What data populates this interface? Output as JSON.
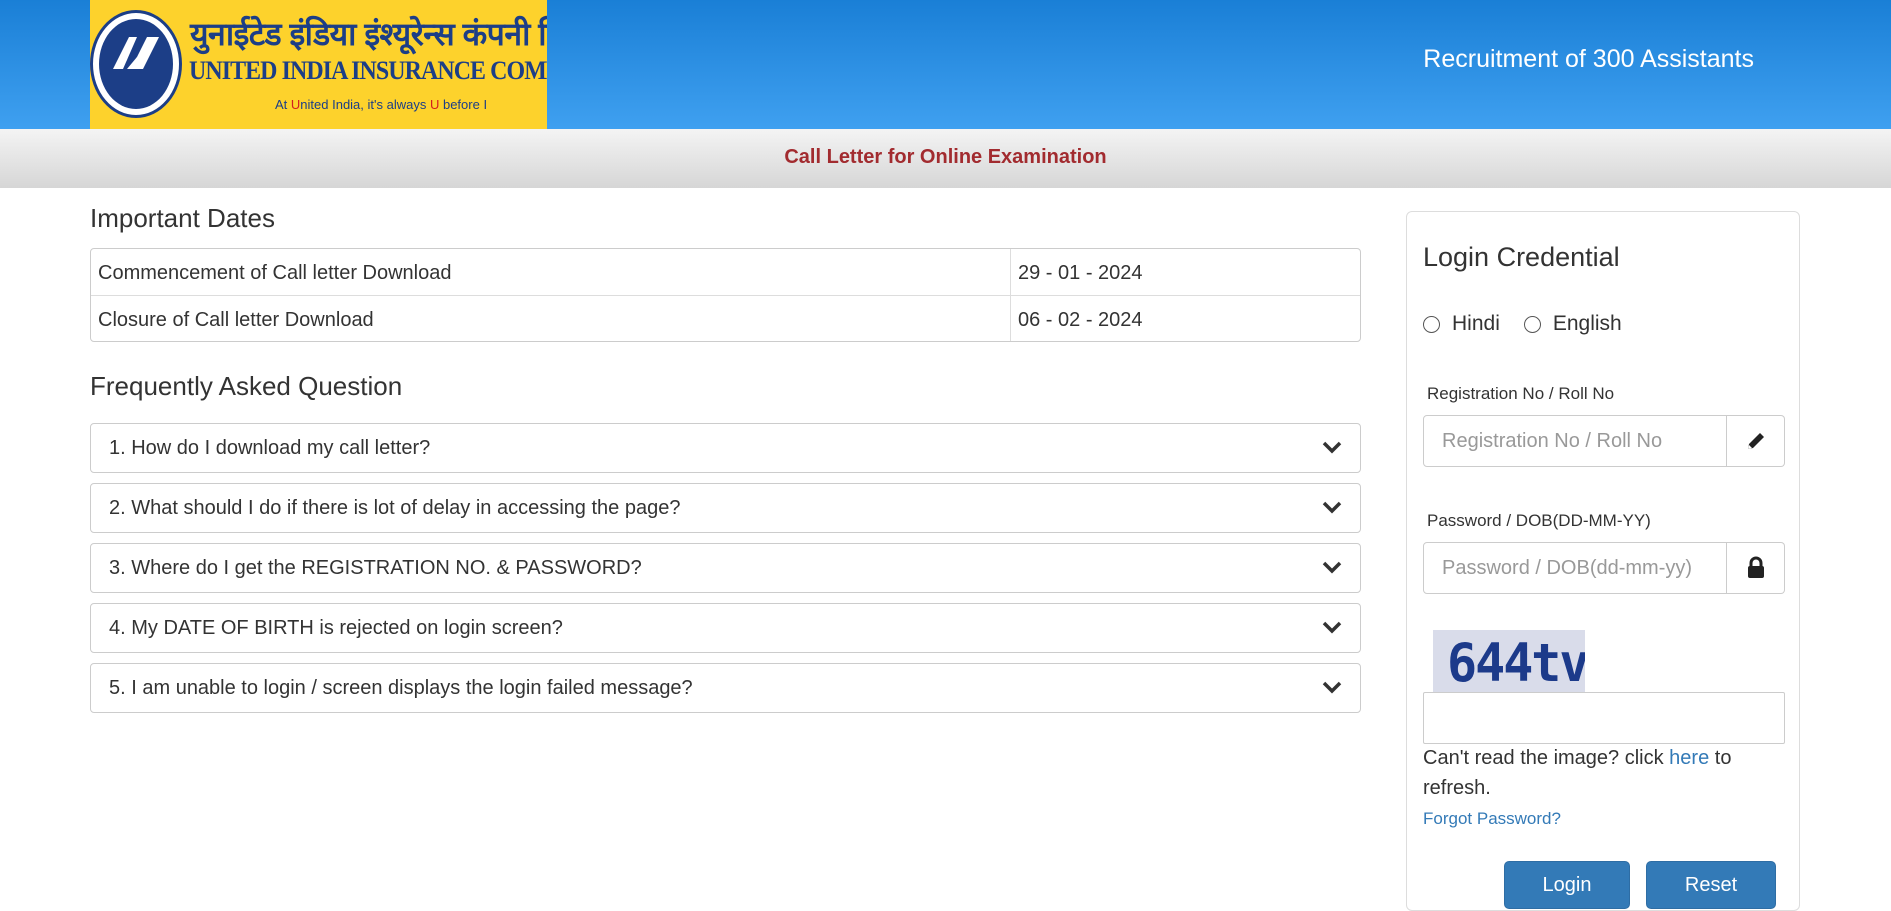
{
  "header": {
    "logo": {
      "hindi_name": "युनाईटेड इंडिया इंश्यूरेन्स कंपनी लिमिटेड",
      "english_name": "UNITED INDIA INSURANCE COMPANY LTD.",
      "tagline_prefix": "At ",
      "tagline_u1": "U",
      "tagline_mid": "nited India, it's always ",
      "tagline_u2": "U",
      "tagline_suffix": " before I",
      "emblem_text": "युनाईटेड इंडिया\nUNITED INDIA"
    },
    "title": "Recruitment of 300 Assistants"
  },
  "subheader": {
    "title": "Call Letter for Online Examination"
  },
  "important_dates": {
    "title": "Important Dates",
    "rows": [
      {
        "label": "Commencement of Call letter Download",
        "value": "29 - 01 - 2024"
      },
      {
        "label": "Closure of Call letter Download",
        "value": "06 - 02 - 2024"
      }
    ]
  },
  "faq": {
    "title": "Frequently Asked Question",
    "items": [
      {
        "question": "1. How do I download my call letter?"
      },
      {
        "question": "2. What should I do if there is lot of delay in accessing the page?"
      },
      {
        "question": "3. Where do I get the REGISTRATION NO. & PASSWORD?"
      },
      {
        "question": "4. My DATE OF BIRTH is rejected on login screen?"
      },
      {
        "question": "5. I am unable to login / screen displays the login failed message?"
      }
    ]
  },
  "login": {
    "title": "Login Credential",
    "language_options": [
      "Hindi",
      "English"
    ],
    "registration_label": "Registration No / Roll No",
    "registration_placeholder": "Registration No / Roll No",
    "password_label": "Password / DOB(DD-MM-YY)",
    "password_placeholder": "Password / DOB(dd-mm-yy)",
    "captcha_text": "644tv",
    "refresh_prefix": "Can't read the image? click ",
    "refresh_link": "here",
    "refresh_suffix": " to refresh.",
    "forgot_password": "Forgot Password?",
    "login_button": "Login",
    "reset_button": "Reset"
  },
  "colors": {
    "header_blue": "#1a7fd6",
    "logo_yellow": "#fdd22c",
    "subheader_red": "#a22b2f",
    "button_blue": "#337ab7",
    "link_blue": "#337ab7"
  }
}
